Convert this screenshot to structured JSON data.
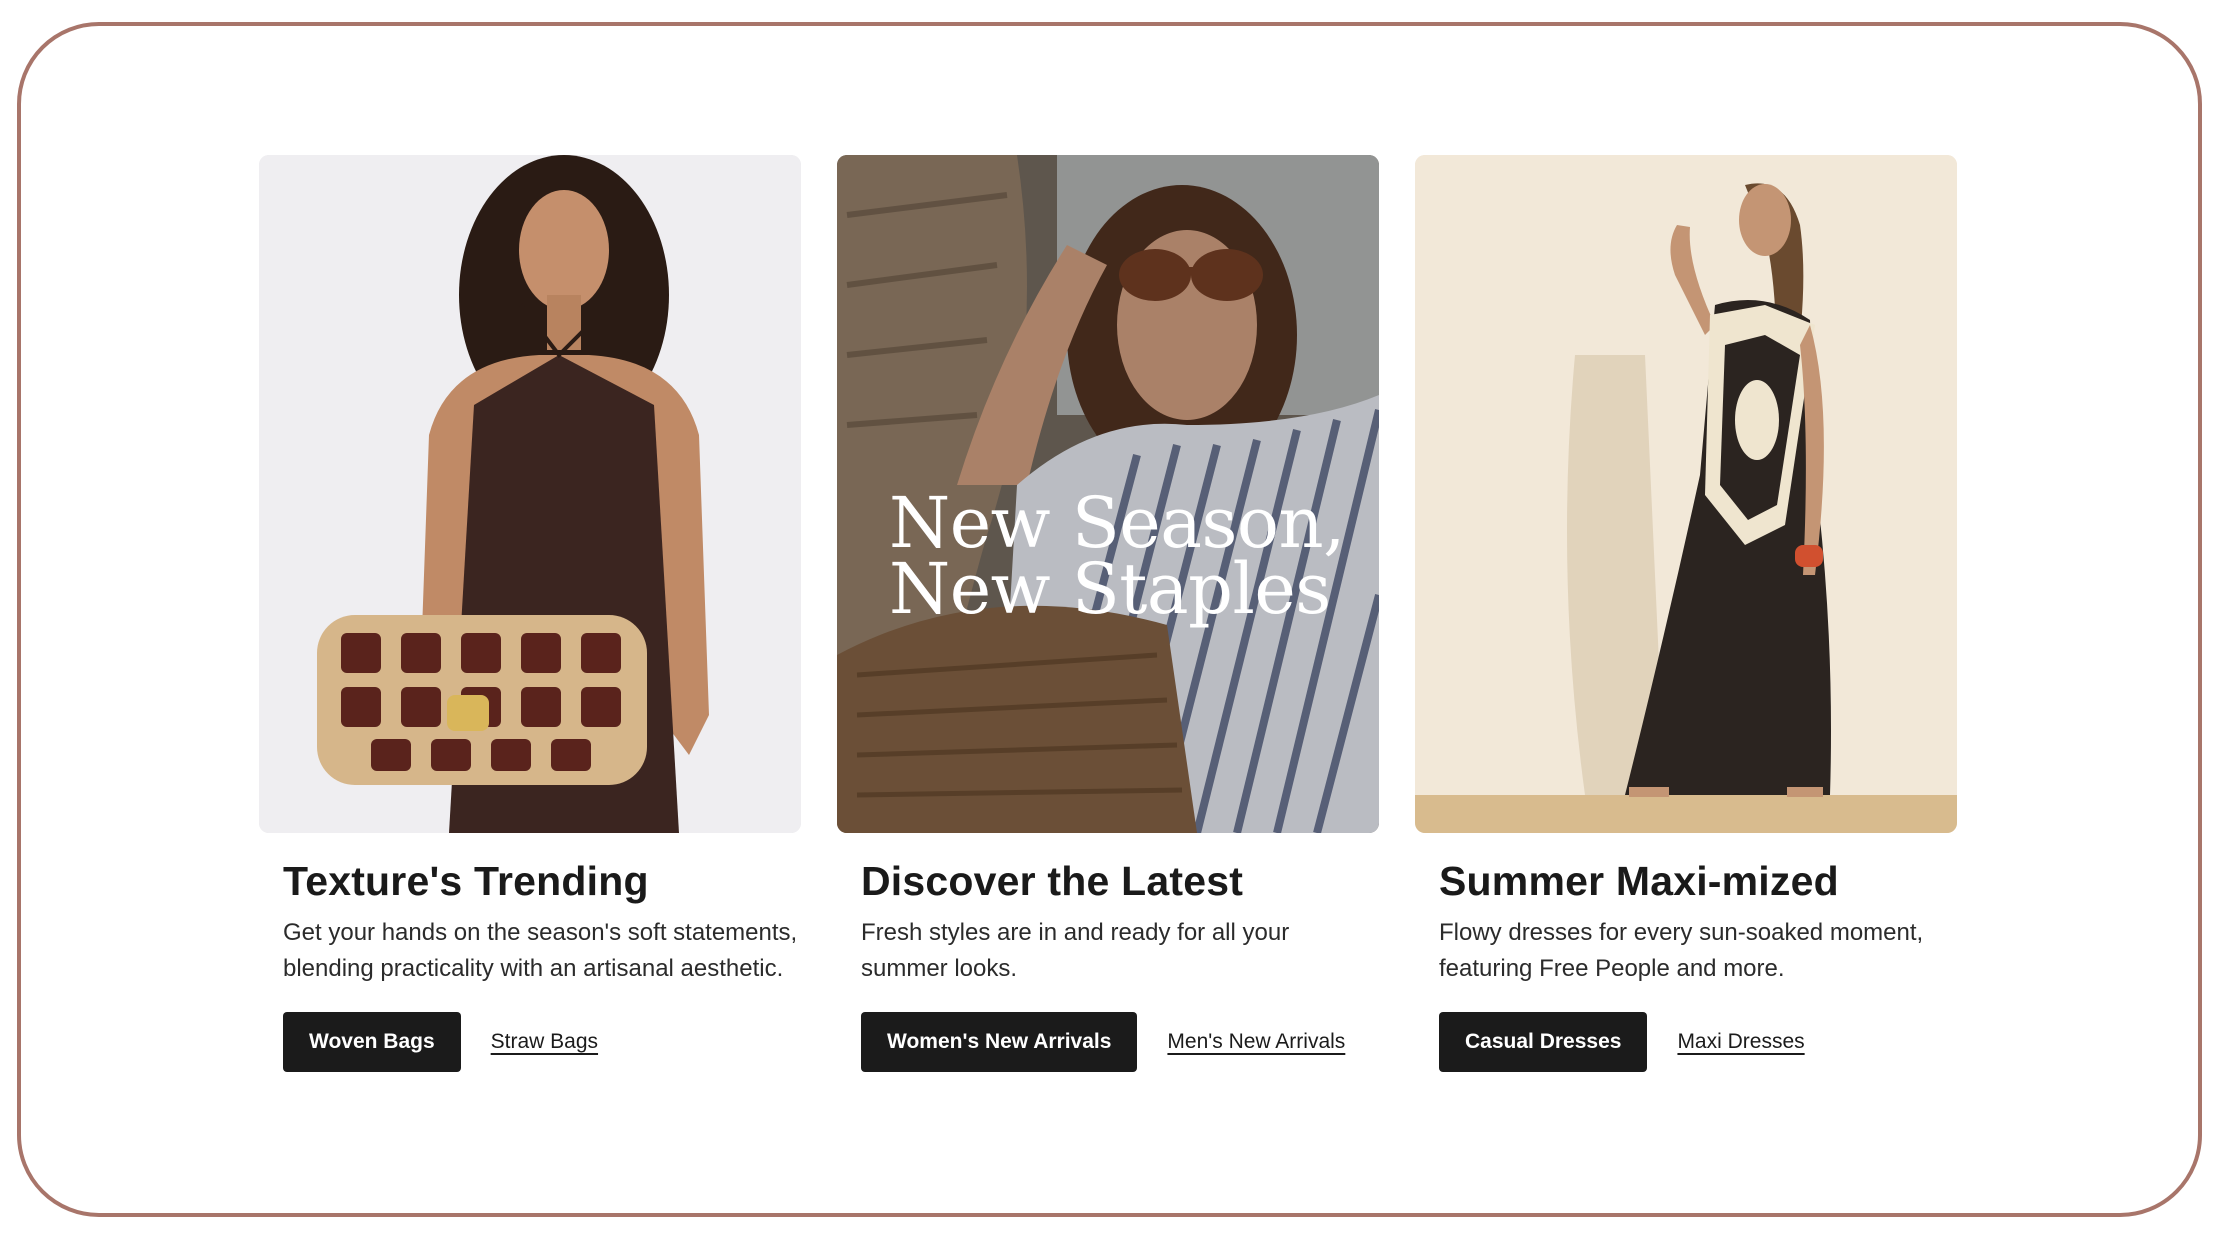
{
  "cards": [
    {
      "title": "Texture's Trending",
      "description": "Get your hands on the season's soft statements, blending practicality with an artisanal aesthetic.",
      "primary_label": "Woven Bags",
      "secondary_label": "Straw Bags"
    },
    {
      "title": "Discover the Latest",
      "description": "Fresh styles are in and ready for all your summer looks.",
      "primary_label": "Women's New Arrivals",
      "secondary_label": "Men's New Arrivals",
      "image_overlay_line1": "New Season,",
      "image_overlay_line2": "New Staples"
    },
    {
      "title": "Summer Maxi-mized",
      "description": "Flowy dresses for every sun-soaked moment, featuring Free People and more.",
      "primary_label": "Casual Dresses",
      "secondary_label": "Maxi Dresses"
    }
  ],
  "colors": {
    "frame_border": "#a8756a",
    "button_bg": "#1b1b1b",
    "button_text": "#ffffff",
    "text": "#1a1a1a"
  }
}
